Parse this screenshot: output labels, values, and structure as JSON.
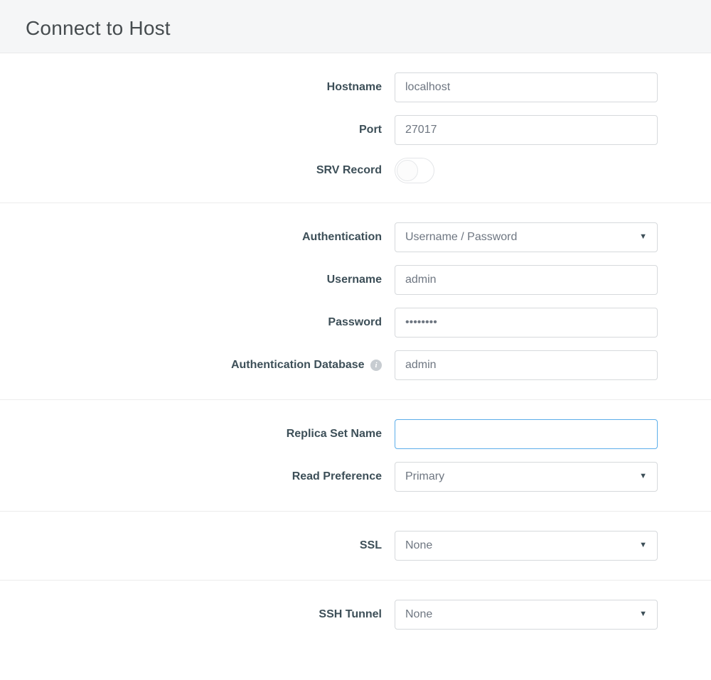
{
  "header": {
    "title": "Connect to Host"
  },
  "hostname": {
    "label": "Hostname",
    "value": "localhost"
  },
  "port": {
    "label": "Port",
    "value": "27017"
  },
  "srv": {
    "label": "SRV Record",
    "on": false
  },
  "auth": {
    "label": "Authentication",
    "value": "Username / Password"
  },
  "username": {
    "label": "Username",
    "value": "admin"
  },
  "password": {
    "label": "Password",
    "value": "••••••••"
  },
  "authdb": {
    "label": "Authentication Database",
    "value": "admin"
  },
  "replset": {
    "label": "Replica Set Name",
    "value": ""
  },
  "readpref": {
    "label": "Read Preference",
    "value": "Primary"
  },
  "ssl": {
    "label": "SSL",
    "value": "None"
  },
  "ssh": {
    "label": "SSH Tunnel",
    "value": "None"
  }
}
